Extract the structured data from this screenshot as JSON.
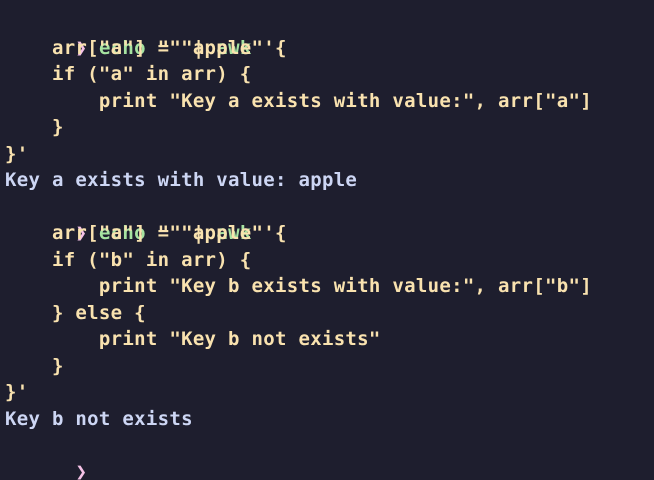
{
  "terminal": {
    "prompt_symbol": "❯",
    "lines": [
      {
        "kind": "cmd",
        "command": "echo",
        "rest": " \"\" | ",
        "pipe_cmd": "awk",
        "tail": " '{"
      },
      {
        "kind": "code",
        "text": "    arr[\"a\"] = \"apple\""
      },
      {
        "kind": "code",
        "text": "    if (\"a\" in arr) {"
      },
      {
        "kind": "code",
        "text": "        print \"Key a exists with value:\", arr[\"a\"]"
      },
      {
        "kind": "code",
        "text": "    }"
      },
      {
        "kind": "code",
        "text": "}'"
      },
      {
        "kind": "out",
        "text": "Key a exists with value: apple"
      },
      {
        "kind": "cmd",
        "command": "echo",
        "rest": " \"\" | ",
        "pipe_cmd": "awk",
        "tail": " '{"
      },
      {
        "kind": "code",
        "text": "    arr[\"a\"] = \"apple\""
      },
      {
        "kind": "code",
        "text": "    if (\"b\" in arr) {"
      },
      {
        "kind": "code",
        "text": "        print \"Key b exists with value:\", arr[\"b\"]"
      },
      {
        "kind": "code",
        "text": "    } else {"
      },
      {
        "kind": "code",
        "text": "        print \"Key b not exists\""
      },
      {
        "kind": "code",
        "text": "    }"
      },
      {
        "kind": "code",
        "text": "}'"
      },
      {
        "kind": "out",
        "text": "Key b not exists"
      },
      {
        "kind": "prompt"
      }
    ]
  },
  "colors": {
    "background": "#1e1e2e",
    "prompt": "#f5c2e7",
    "command": "#a6e3a1",
    "code": "#f9e2af",
    "output": "#cdd6f4"
  }
}
